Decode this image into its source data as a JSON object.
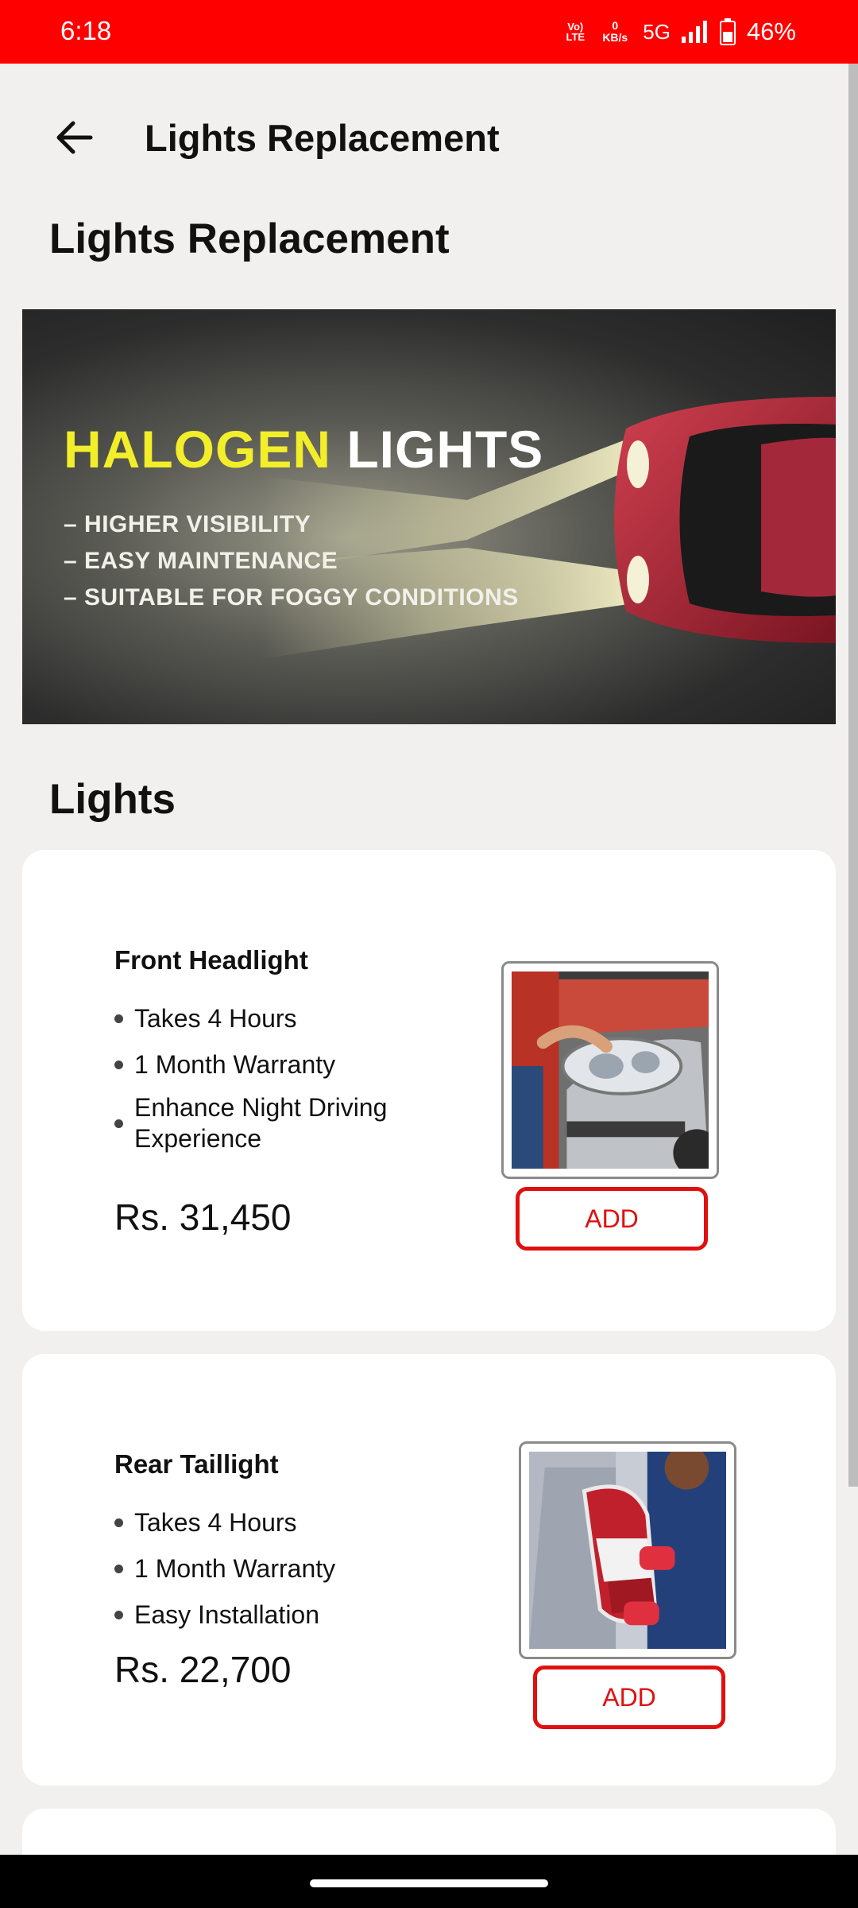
{
  "status_bar": {
    "time": "6:18",
    "lte_label": "Vo) LTE",
    "data_speed": "0 KB/s",
    "network": "5G",
    "battery": "46%"
  },
  "app_bar": {
    "title": "Lights Replacement",
    "back_icon": "arrow-left-icon"
  },
  "page_title": "Lights Replacement",
  "banner": {
    "headline_highlight": "HALOGEN",
    "headline_rest": "LIGHTS",
    "points": [
      "HIGHER VISIBILITY",
      "EASY MAINTENANCE",
      "SUITABLE FOR FOGGY CONDITIONS"
    ],
    "highlight_color": "#f3ee2a"
  },
  "section_title": "Lights",
  "products": [
    {
      "name": "Front Headlight",
      "features": [
        "Takes 4 Hours",
        "1 Month Warranty",
        "Enhance Night Driving Experience"
      ],
      "price": "Rs. 31,450",
      "button": "ADD"
    },
    {
      "name": "Rear Taillight",
      "features": [
        "Takes 4 Hours",
        "1 Month Warranty",
        "Easy Installation"
      ],
      "price": "Rs. 22,700",
      "button": "ADD"
    }
  ],
  "colors": {
    "status_bar": "#ff0000",
    "accent": "#e01010",
    "background": "#f2f0ef"
  }
}
